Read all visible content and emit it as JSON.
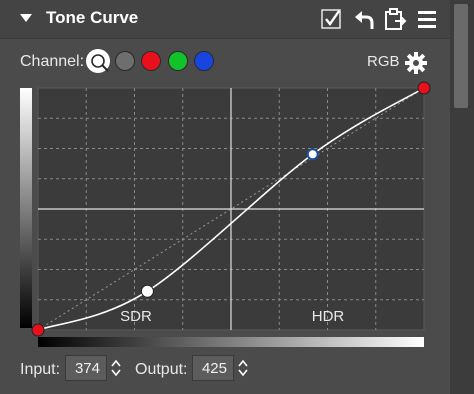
{
  "panel": {
    "title": "Tone Curve",
    "header_icons": [
      "checkbox-check-icon",
      "undo-arrow-icon",
      "clipboard-paste-icon",
      "hamburger-menu-icon"
    ]
  },
  "channel": {
    "label": "Channel:",
    "options": [
      {
        "name": "luminance",
        "color": "#ffffff",
        "selected": true
      },
      {
        "name": "gray",
        "color": "#6e6e6e"
      },
      {
        "name": "red",
        "color": "#e8101a"
      },
      {
        "name": "green",
        "color": "#12c22a"
      },
      {
        "name": "blue",
        "color": "#1844e0"
      }
    ],
    "current": "RGB"
  },
  "graph": {
    "zone_labels": [
      "SDR",
      "HDR"
    ],
    "curve_points": [
      {
        "input": 0,
        "output": 0,
        "color": "#e8101a"
      },
      {
        "input": 290,
        "output": 164,
        "color": "#ffffff"
      },
      {
        "input": 728,
        "output": 743,
        "color": "#ffffff",
        "active": true
      },
      {
        "input": 1023,
        "output": 1023,
        "color": "#e8101a"
      }
    ],
    "range": [
      0,
      1023
    ]
  },
  "io": {
    "input_label": "Input:",
    "input_value": "374",
    "output_label": "Output:",
    "output_value": "425"
  }
}
